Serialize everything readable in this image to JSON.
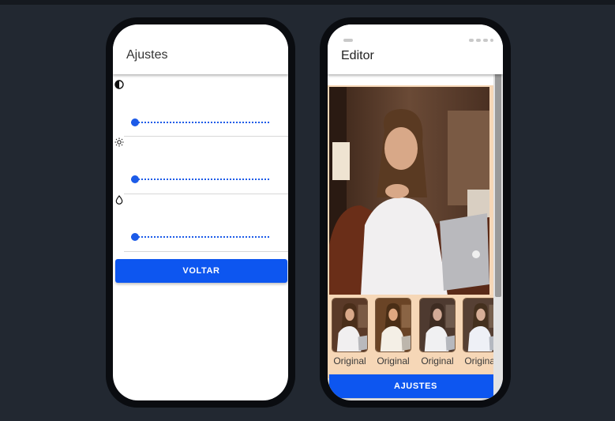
{
  "left_phone": {
    "appbar_title": "Ajustes",
    "adjustments": [
      {
        "icon": "contrast-icon",
        "slider_value": 0.0
      },
      {
        "icon": "brightness-icon",
        "slider_value": 0.0
      },
      {
        "icon": "saturation-drop-icon",
        "slider_value": 0.0
      }
    ],
    "back_button_label": "VOLTAR"
  },
  "right_phone": {
    "appbar_title": "Editor",
    "filters": [
      {
        "label": "Original"
      },
      {
        "label": "Original"
      },
      {
        "label": "Original"
      },
      {
        "label": "Original"
      }
    ],
    "adjust_button_label": "AJUSTES"
  },
  "colors": {
    "background": "#222831",
    "accent": "#0d56f0",
    "filter_bar": "#f6d7b7"
  }
}
